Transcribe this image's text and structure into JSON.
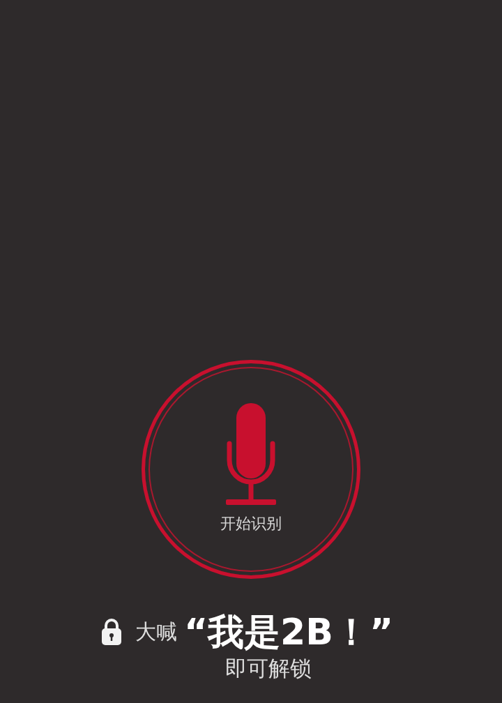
{
  "voice_button": {
    "label": "开始识别"
  },
  "prompt": {
    "lead": "大喊",
    "phrase": "“我是2B！”",
    "tail": "即可解锁"
  }
}
